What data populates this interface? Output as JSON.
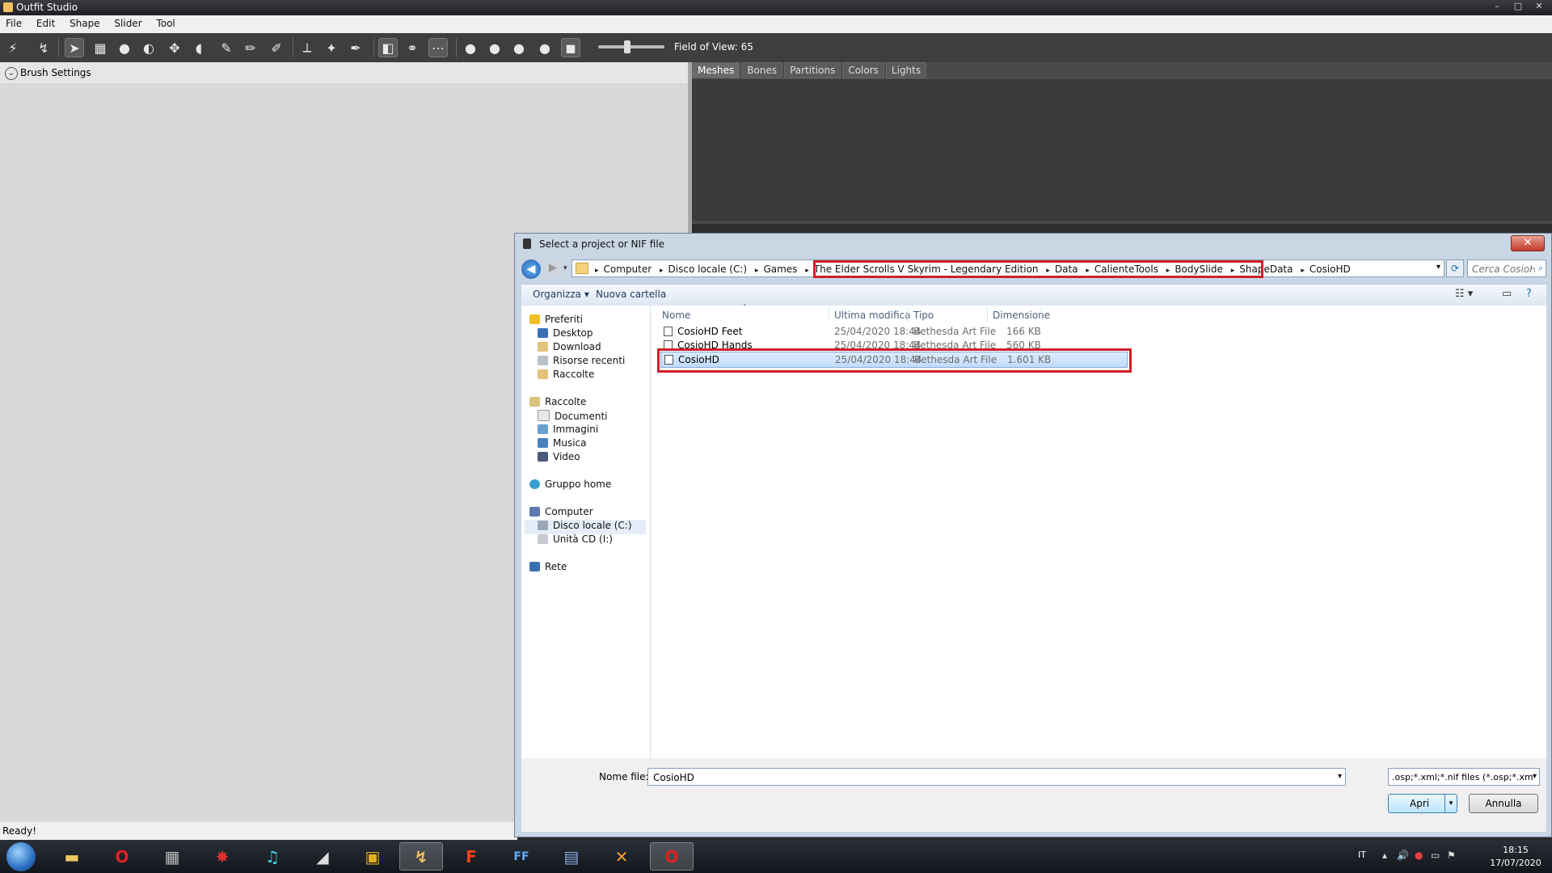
{
  "window": {
    "title": "Outfit Studio",
    "min": "–",
    "max": "□",
    "close": "✕"
  },
  "menu": [
    "File",
    "Edit",
    "Shape",
    "Slider",
    "Tool"
  ],
  "toolbar": {
    "fov_label": "Field of View: 65",
    "fov_value": 65
  },
  "left_panel": {
    "brush_settings": "Brush Settings"
  },
  "right_panel": {
    "tabs": [
      "Meshes",
      "Bones",
      "Partitions",
      "Colors",
      "Lights"
    ],
    "active_tab": "Meshes"
  },
  "status": {
    "text": "Ready!"
  },
  "dialog": {
    "title": "Select a project or NIF file",
    "close": "✕",
    "breadcrumb": [
      "Computer",
      "Disco locale (C:)",
      "Games",
      "The Elder Scrolls V Skyrim - Legendary Edition",
      "Data",
      "CalienteTools",
      "BodySlide",
      "ShapeData",
      "CosioHD"
    ],
    "search_placeholder": "Cerca CosioHD",
    "commands": {
      "organize": "Organizza ▾",
      "new_folder": "Nuova cartella"
    },
    "nav": {
      "favorites": "Preferiti",
      "favorites_items": [
        "Desktop",
        "Download",
        "Risorse recenti",
        "Raccolte"
      ],
      "libraries": "Raccolte",
      "libraries_items": [
        "Documenti",
        "Immagini",
        "Musica",
        "Video"
      ],
      "homegroup": "Gruppo home",
      "computer": "Computer",
      "computer_items": [
        "Disco locale (C:)",
        "Unità CD (I:)"
      ],
      "network": "Rete"
    },
    "columns": {
      "name": "Nome",
      "modified": "Ultima modifica",
      "type": "Tipo",
      "size": "Dimensione"
    },
    "files": [
      {
        "name": "CosioHD Feet",
        "modified": "25/04/2020 18:44",
        "type": "Bethesda Art File",
        "size": "166 KB"
      },
      {
        "name": "CosioHD Hands",
        "modified": "25/04/2020 18:44",
        "type": "Bethesda Art File",
        "size": "560 KB"
      },
      {
        "name": "CosioHD",
        "modified": "25/04/2020 18:44",
        "type": "Bethesda Art File",
        "size": "1.601 KB"
      }
    ],
    "selected_file": "CosioHD",
    "filename_label": "Nome file:",
    "filename_value": "CosioHD",
    "filter": ".osp;*.xml;*.nif files (*.osp;*.xml",
    "open": "Apri",
    "cancel": "Annulla"
  },
  "tray": {
    "lang": "IT",
    "time": "18:15",
    "date": "17/07/2020"
  },
  "colors": {
    "highlight_red": "#d0202a",
    "selection_blue": "#c2dcfd"
  }
}
